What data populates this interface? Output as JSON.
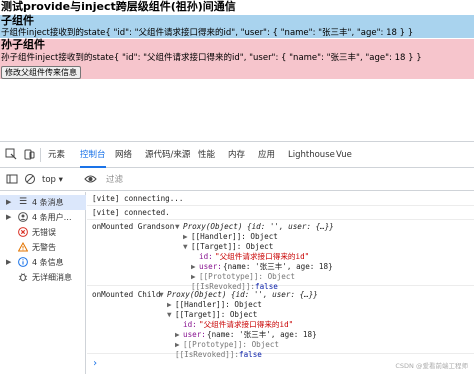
{
  "page": {
    "title": "测试provide与inject跨层级组件(祖孙)间通信",
    "child": {
      "title": "子组件",
      "line": "子组件inject接收到的state{ \"id\": \"父组件请求接口得来的id\", \"user\": { \"name\": \"张三丰\", \"age\": 18 } }"
    },
    "grandson": {
      "title": "孙子组件",
      "line": "孙子组件inject接收到的state{ \"id\": \"父组件请求接口得来的id\", \"user\": { \"name\": \"张三丰\", \"age\": 18 } }",
      "button_label": "修改父组件传来信息"
    }
  },
  "devtools": {
    "tabs": [
      "元素",
      "控制台",
      "网络",
      "源代码/来源",
      "性能",
      "内存",
      "应用",
      "Lighthouse",
      "Vue"
    ],
    "active_tab": "控制台",
    "toolbar": {
      "context": "top",
      "filter_placeholder": "过滤"
    },
    "sidebar": [
      {
        "icon": "list-icon",
        "label": "4 条消息",
        "selected": true
      },
      {
        "icon": "user-icon",
        "label": "4 条用户…",
        "selected": false
      },
      {
        "icon": "error-icon",
        "label": "无错误",
        "selected": false
      },
      {
        "icon": "warning-icon",
        "label": "无警告",
        "selected": false
      },
      {
        "icon": "info-icon",
        "label": "4 条信息",
        "selected": false
      },
      {
        "icon": "bug-icon",
        "label": "无详细消息",
        "selected": false
      }
    ],
    "console": {
      "msg1": "[vite] connecting...",
      "msg2": "[vite] connected.",
      "grandson": {
        "label": "onMounted Grandson",
        "proxy_summary": "Proxy(Object) {id: '', user: {…}}",
        "handler": "[[Handler]]: Object",
        "target": "[[Target]]: Object",
        "id_key": "id:",
        "id_val": "\"父组件请求接口得来的id\"",
        "user_key": "user:",
        "user_val": "{name: '张三丰', age: 18}",
        "prototype": "[[Prototype]]: Object",
        "revoked_key": "[[IsRevoked]]:",
        "revoked_val": "false"
      },
      "child": {
        "label": "onMounted Child",
        "proxy_summary": "Proxy(Object) {id: '', user: {…}}",
        "handler": "[[Handler]]: Object",
        "target": "[[Target]]: Object",
        "id_key": "id:",
        "id_val": "\"父组件请求接口得来的id\"",
        "user_key": "user:",
        "user_val": "{name: '张三丰', age: 18}",
        "prototype": "[[Prototype]]: Object",
        "revoked_key": "[[IsRevoked]]:",
        "revoked_val": "false"
      },
      "prompt": "›"
    },
    "watermark": "CSDN @爱看前端工程师"
  }
}
